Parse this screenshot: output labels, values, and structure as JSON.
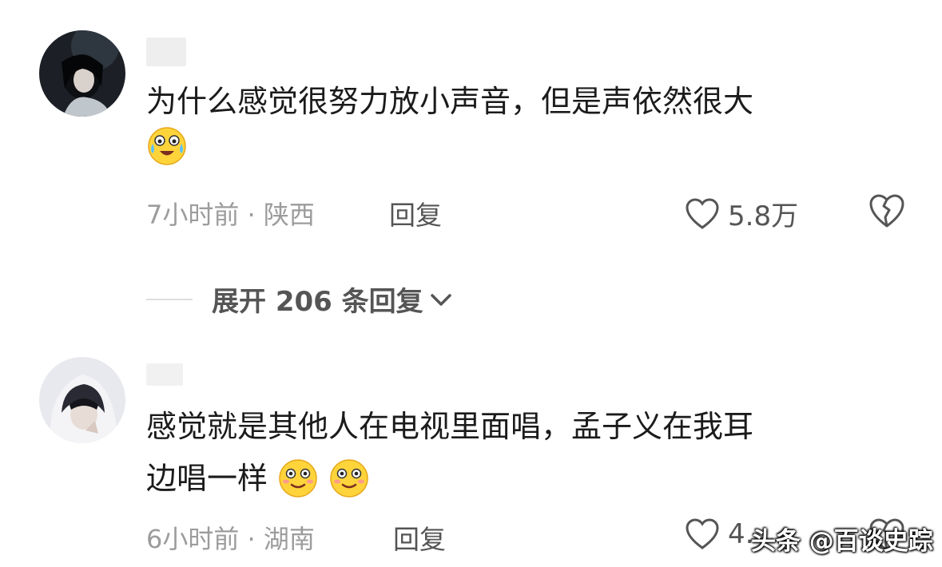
{
  "comments": [
    {
      "text_line1": "为什么感觉很努力放小声音，但是声依然很大",
      "emoji_icon": "laughing-crying-emoji-icon",
      "time": "7小时前",
      "separator": "·",
      "location": "陕西",
      "reply_label": "回复",
      "likes": "5.8万"
    },
    {
      "text_line1": "感觉就是其他人在电视里面唱，孟子义在我耳",
      "text_line2": "边唱一样",
      "emoji_icon": "smiling-blush-emoji-icon",
      "time": "6小时前",
      "separator": "·",
      "location": "湖南",
      "reply_label": "回复",
      "likes": "4."
    }
  ],
  "expand_replies": {
    "label": "展开 206 条回复",
    "icon": "chevron-down-icon"
  },
  "watermark": "头条 @百谈史踪",
  "colors": {
    "text": "#1b1b1b",
    "meta": "#9c9c9c",
    "action": "#555555",
    "background": "#ffffff"
  }
}
